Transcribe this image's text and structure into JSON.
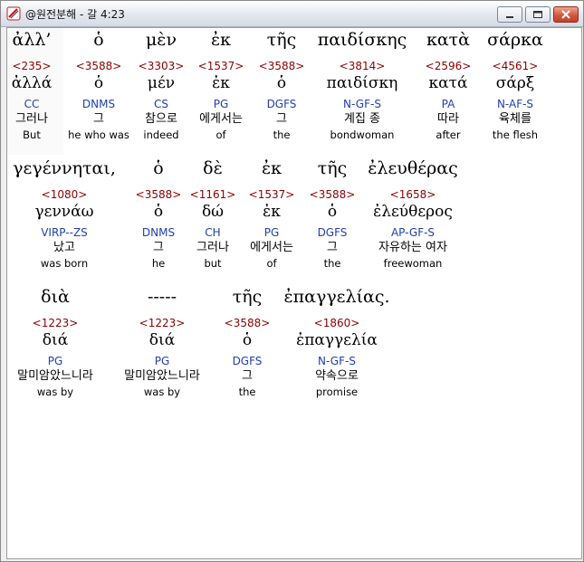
{
  "window": {
    "title": "@원전분해 - 갈 4:23"
  },
  "rows": [
    {
      "words": [
        {
          "greek": "ἀλλ’",
          "strong": "<235>",
          "lemma": "ἀλλά",
          "pos": "CC",
          "korean": "그러나",
          "english": "But",
          "selected": true
        },
        {
          "greek": "ὁ",
          "strong": "<3588>",
          "lemma": "ὁ",
          "pos": "DNMS",
          "korean": "그",
          "english": "he who was"
        },
        {
          "greek": "μὲν",
          "strong": "<3303>",
          "lemma": "μέν",
          "pos": "CS",
          "korean": "참으로",
          "english": "indeed"
        },
        {
          "greek": "ἐκ",
          "strong": "<1537>",
          "lemma": "ἐκ",
          "pos": "PG",
          "korean": "에게서는",
          "english": "of"
        },
        {
          "greek": "τῆς",
          "strong": "<3588>",
          "lemma": "ὁ",
          "pos": "DGFS",
          "korean": "그",
          "english": "the"
        },
        {
          "greek": "παιδίσκης",
          "strong": "<3814>",
          "lemma": "παιδίσκη",
          "pos": "N-GF-S",
          "korean": "계집 종",
          "english": "bondwoman"
        },
        {
          "greek": "κατὰ",
          "strong": "<2596>",
          "lemma": "κατά",
          "pos": "PA",
          "korean": "따라",
          "english": "after"
        },
        {
          "greek": "σάρκα",
          "strong": "<4561>",
          "lemma": "σάρξ",
          "pos": "N-AF-S",
          "korean": "육체를",
          "english": "the flesh"
        }
      ]
    },
    {
      "words": [
        {
          "greek": "γεγέννηται,",
          "strong": "<1080>",
          "lemma": "γεννάω",
          "pos": "VIRP--ZS",
          "korean": "났고",
          "english": "was born"
        },
        {
          "greek": "ὁ",
          "strong": "<3588>",
          "lemma": "ὁ",
          "pos": "DNMS",
          "korean": "그",
          "english": "he"
        },
        {
          "greek": "δὲ",
          "strong": "<1161>",
          "lemma": "δώ",
          "pos": "CH",
          "korean": "그러나",
          "english": "but"
        },
        {
          "greek": "ἐκ",
          "strong": "<1537>",
          "lemma": "ἐκ",
          "pos": "PG",
          "korean": "에게서는",
          "english": "of"
        },
        {
          "greek": "τῆς",
          "strong": "<3588>",
          "lemma": "ὁ",
          "pos": "DGFS",
          "korean": "그",
          "english": "the"
        },
        {
          "greek": "ἐλευθέρας",
          "strong": "<1658>",
          "lemma": "ἐλεύθερος",
          "pos": "AP-GF-S",
          "korean": "자유하는 여자",
          "english": "freewoman"
        }
      ]
    },
    {
      "words": [
        {
          "greek": "διὰ",
          "strong": "<1223>",
          "lemma": "διά",
          "pos": "PG",
          "korean": "말미암았느니라",
          "english": "was by"
        },
        {
          "greek": "-----",
          "strong": "<1223>",
          "lemma": "διά",
          "pos": "PG",
          "korean": "말미암았느니라",
          "english": "was by"
        },
        {
          "greek": "τῆς",
          "strong": "<3588>",
          "lemma": "ὁ",
          "pos": "DGFS",
          "korean": "그",
          "english": "the"
        },
        {
          "greek": "ἐπαγγελίας.",
          "strong": "<1860>",
          "lemma": "ἐπαγγελία",
          "pos": "N-GF-S",
          "korean": "약속으로",
          "english": "promise"
        }
      ]
    }
  ]
}
